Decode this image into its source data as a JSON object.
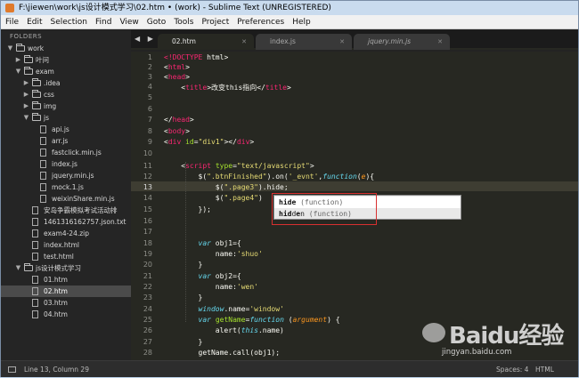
{
  "window": {
    "title": "F:\\jiewen\\work\\js设计模式学习\\02.htm • (work) - Sublime Text (UNREGISTERED)"
  },
  "menu": [
    "File",
    "Edit",
    "Selection",
    "Find",
    "View",
    "Goto",
    "Tools",
    "Project",
    "Preferences",
    "Help"
  ],
  "sidebar": {
    "header": "FOLDERS",
    "items": [
      {
        "label": "work",
        "type": "folder",
        "open": true
      },
      {
        "label": "叶问",
        "type": "folder",
        "open": false
      },
      {
        "label": "exam",
        "type": "folder",
        "open": true
      },
      {
        "label": ".idea",
        "type": "folder",
        "open": false
      },
      {
        "label": "css",
        "type": "folder",
        "open": false
      },
      {
        "label": "img",
        "type": "folder",
        "open": false
      },
      {
        "label": "js",
        "type": "folder",
        "open": true
      },
      {
        "label": "api.js",
        "type": "file"
      },
      {
        "label": "arr.js",
        "type": "file"
      },
      {
        "label": "fastclick.min.js",
        "type": "file"
      },
      {
        "label": "index.js",
        "type": "file"
      },
      {
        "label": "jquery.min.js",
        "type": "file"
      },
      {
        "label": "mock.1.js",
        "type": "file"
      },
      {
        "label": "weixinShare.min.js",
        "type": "file"
      },
      {
        "label": "安岛争霸模拟考试活动排",
        "type": "file"
      },
      {
        "label": "1461316162757.json.txt",
        "type": "file"
      },
      {
        "label": "exam4-24.zip",
        "type": "file"
      },
      {
        "label": "index.html",
        "type": "file"
      },
      {
        "label": "test.html",
        "type": "file"
      },
      {
        "label": "js设计模式学习",
        "type": "folder",
        "open": true
      },
      {
        "label": "01.htm",
        "type": "file"
      },
      {
        "label": "02.htm",
        "type": "file",
        "selected": true
      },
      {
        "label": "03.htm",
        "type": "file"
      },
      {
        "label": "04.htm",
        "type": "file"
      }
    ]
  },
  "tabs": [
    {
      "label": "02.htm",
      "active": true
    },
    {
      "label": "index.js",
      "active": false
    },
    {
      "label": "jquery.min.js",
      "active": false
    }
  ],
  "editor": {
    "line_numbers": [
      "1",
      "2",
      "3",
      "4",
      "5",
      "6",
      "7",
      "8",
      "9",
      "10",
      "11",
      "12",
      "13",
      "14",
      "15",
      "16",
      "17",
      "18",
      "19",
      "20",
      "21",
      "22",
      "23",
      "24",
      "25",
      "26",
      "27",
      "28"
    ],
    "current_line": "13"
  },
  "autocomplete": {
    "items": [
      {
        "match": "hide",
        "rest": "",
        "hint": "(function)"
      },
      {
        "match": "hid",
        "mid": "d",
        "match2": "e",
        "rest": "n",
        "hint": "(function)"
      }
    ]
  },
  "status": {
    "position": "Line 13, Column 29",
    "spaces": "Spaces: 4",
    "syntax": "HTML"
  },
  "watermark": {
    "brand": "Baidu经验",
    "url": "jingyan.baidu.com"
  },
  "colors": {
    "editor_bg": "#272822",
    "sidebar_bg": "#252525",
    "tag": "#f92672",
    "attr": "#a6e22e",
    "string": "#e6db74",
    "keyword": "#66d9ef"
  }
}
